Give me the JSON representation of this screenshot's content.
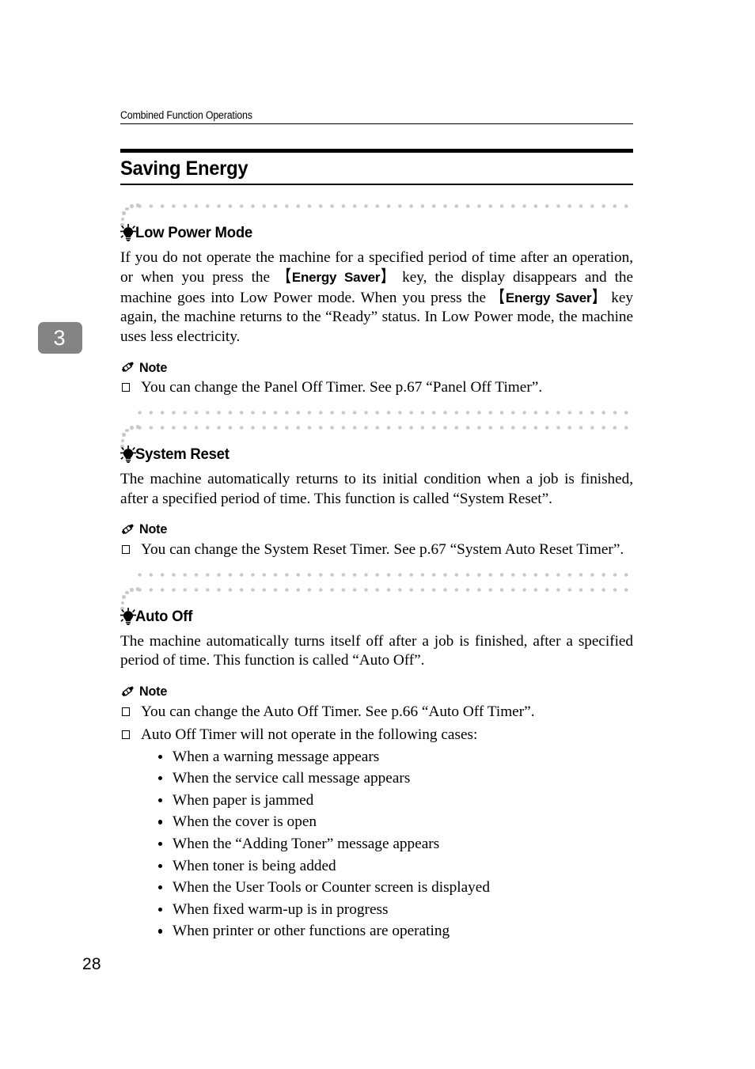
{
  "header": {
    "running_head": "Combined Function Operations"
  },
  "chapter_tab": {
    "number": "3"
  },
  "section": {
    "title": "Saving Energy"
  },
  "blocks": [
    {
      "icon": "lightbulb-icon",
      "title": "Low Power Mode",
      "paragraph_part1": "If you do not operate the machine for a specified period of time after an operation, or when you press the ",
      "keycap1": "Energy Saver",
      "paragraph_part2": " key, the display disappears and the machine goes into Low Power mode. When you press the ",
      "keycap2": "Energy Saver",
      "paragraph_part3": " key again, the machine returns to the “Ready” status. In Low Power mode, the machine uses less electricity.",
      "note_label": "Note",
      "notes": [
        "You can change the Panel Off Timer. See p.67 “Panel Off Timer”."
      ]
    },
    {
      "icon": "lightbulb-icon",
      "title": "System Reset",
      "paragraph": "The machine automatically returns to its initial condition when a job is finished, after a specified period of time. This function is called “System Reset”.",
      "note_label": "Note",
      "notes": [
        "You can change the System Reset Timer. See p.67 “System Auto Reset Timer”."
      ]
    },
    {
      "icon": "lightbulb-icon",
      "title": "Auto Off",
      "paragraph": "The machine automatically turns itself off after a job is finished, after a specified period of time. This function is called “Auto Off”.",
      "note_label": "Note",
      "notes": [
        "You can change the Auto Off Timer. See p.66 “Auto Off Timer”.",
        "Auto Off Timer will not operate in the following cases:"
      ],
      "bullets": [
        "When a warning message appears",
        "When the service call message appears",
        "When paper is jammed",
        "When the cover is open",
        "When the “Adding Toner” message appears",
        "When toner is being added",
        "When the User Tools or Counter screen is displayed",
        "When fixed warm-up is in progress",
        "When printer or other functions are operating"
      ]
    }
  ],
  "folio": {
    "page_number": "28"
  },
  "colors": {
    "text": "#000000",
    "tab_background": "#848484",
    "tab_text": "#ffffff",
    "dotted_rule": "#c9c9c9",
    "page_background": "#ffffff"
  }
}
